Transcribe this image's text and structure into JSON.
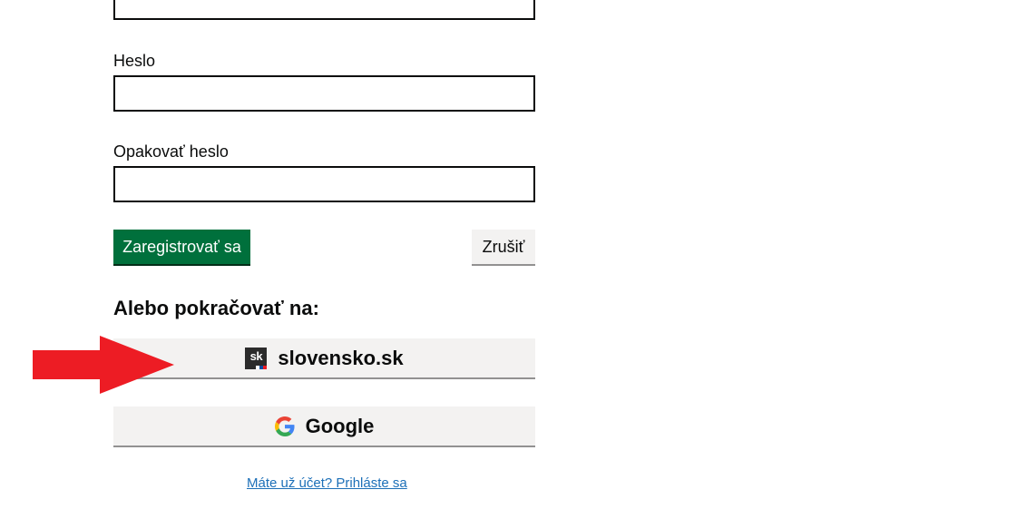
{
  "form": {
    "password_label": "Heslo",
    "password_value": "",
    "repeat_password_label": "Opakovať heslo",
    "repeat_password_value": "",
    "register_button": "Zaregistrovať sa",
    "cancel_button": "Zrušiť"
  },
  "alternatives": {
    "heading": "Alebo pokračovať na:",
    "slovensko": {
      "label": "slovensko.sk",
      "logo_text": "sk"
    },
    "google": {
      "label": "Google"
    }
  },
  "footer": {
    "login_link": "Máte už účet? Prihláste sa"
  },
  "colors": {
    "primary": "#00703c",
    "secondary_bg": "#f3f2f1",
    "link": "#1d70b8",
    "annotation_arrow": "#ed1c24"
  },
  "icons": {
    "slovensko": "slovensko-sk-logo-icon",
    "google": "google-g-icon",
    "annotation": "red-arrow-icon"
  }
}
